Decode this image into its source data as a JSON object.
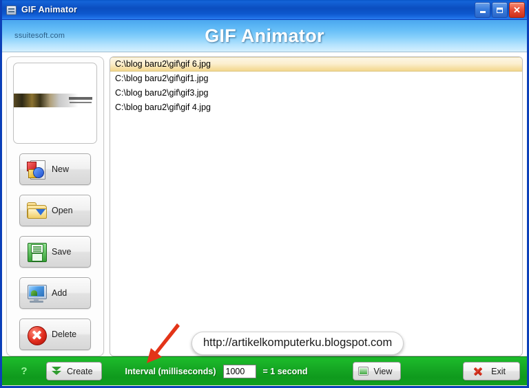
{
  "window": {
    "title": "GIF Animator",
    "icon": "app-filmreel-icon",
    "buttons": {
      "minimize": "_",
      "maximize": "□",
      "close": "✕"
    }
  },
  "banner": {
    "brand": "ssuitesoft.com",
    "title": "GIF Animator"
  },
  "sidebar": {
    "preview_alt": "frame-preview",
    "buttons": [
      {
        "label": "New",
        "icon": "new-document-icon"
      },
      {
        "label": "Open",
        "icon": "open-folder-icon"
      },
      {
        "label": "Save",
        "icon": "floppy-disk-icon"
      },
      {
        "label": "Add",
        "icon": "add-monitor-icon"
      },
      {
        "label": "Delete",
        "icon": "delete-circle-x-icon"
      }
    ]
  },
  "file_list": {
    "items": [
      {
        "path": "C:\\blog baru2\\gif\\gif 6.jpg",
        "selected": true
      },
      {
        "path": "C:\\blog baru2\\gif\\gif1.jpg",
        "selected": false
      },
      {
        "path": "C:\\blog baru2\\gif\\gif3.jpg",
        "selected": false
      },
      {
        "path": "C:\\blog baru2\\gif\\gif 4.jpg",
        "selected": false
      }
    ]
  },
  "callout": {
    "url": "http://artikelkomputerku.blogspot.com"
  },
  "toolbar": {
    "help": "?",
    "create_label": "Create",
    "interval_label": "Interval (milliseconds)",
    "interval_value": "1000",
    "interval_equals": "= 1 second",
    "view_label": "View",
    "exit_label": "Exit"
  },
  "colors": {
    "titlebar_blue": "#0b4ec0",
    "banner_blue": "#64bdf7",
    "toolbar_green": "#16a824",
    "selection_gold": "#f3d88f",
    "accent_red": "#e02b1c"
  }
}
